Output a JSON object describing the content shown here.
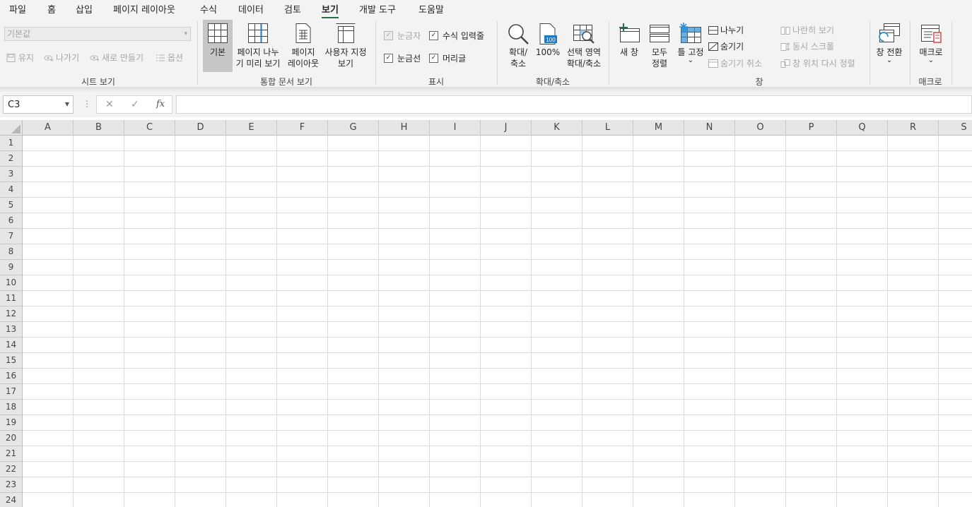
{
  "menu_tabs": [
    "파일",
    "홈",
    "삽입",
    "페이지 레이아웃",
    "수식",
    "데이터",
    "검토",
    "보기",
    "개발 도구",
    "도움말"
  ],
  "active_tab": "보기",
  "ribbon": {
    "sheet_view": {
      "select_value": "기본값",
      "keep": "유지",
      "exit": "나가기",
      "new": "새로 만들기",
      "options": "옵션",
      "group_label": "시트 보기"
    },
    "workbook_views": {
      "normal": "기본",
      "page_break": "페이지 나누\n기 미리 보기",
      "page_layout": "페이지\n레이아웃",
      "custom": "사용자 지정\n보기",
      "group_label": "통합 문서 보기"
    },
    "show": {
      "ruler": "눈금자",
      "formula_bar": "수식 입력줄",
      "gridlines": "눈금선",
      "headings": "머리글",
      "group_label": "표시"
    },
    "zoom": {
      "zoom": "확대/\n축소",
      "hundred": "100%",
      "to_selection": "선택 영역\n확대/축소",
      "group_label": "확대/축소",
      "icon_text": "100"
    },
    "window": {
      "new_window": "새 창",
      "arrange_all": "모두\n정렬",
      "freeze": "틀 고정",
      "split": "나누기",
      "hide": "숨기기",
      "unhide": "숨기기 취소",
      "side_by_side": "나란히 보기",
      "sync_scroll": "동시 스크롤",
      "reset_position": "창 위치 다시 정렬",
      "switch": "창 전환",
      "group_label": "창"
    },
    "macros": {
      "macros": "매크로",
      "group_label": "매크로"
    }
  },
  "formula_bar": {
    "name_box": "C3",
    "formula": "",
    "fx_label": "fx"
  },
  "grid": {
    "columns": [
      "A",
      "B",
      "C",
      "D",
      "E",
      "F",
      "G",
      "H",
      "I",
      "J",
      "K",
      "L",
      "M",
      "N",
      "O",
      "P",
      "Q",
      "R",
      "S"
    ],
    "rows": [
      "1",
      "2",
      "3",
      "4",
      "5",
      "6",
      "7",
      "8",
      "9",
      "10",
      "11",
      "12",
      "13",
      "14",
      "15",
      "16",
      "17",
      "18",
      "19",
      "20",
      "21",
      "22",
      "23",
      "24"
    ]
  },
  "colors": {
    "accent": "#217346",
    "ribbon_bg": "#f3f3f3",
    "gridline": "#dcdcdc",
    "header_bg": "#e6e6e6",
    "pressed_button": "#c6c6c6",
    "zoom_badge": "#1e7ac4",
    "freeze_icon": "#2e8fd4",
    "macro_icon": "#d83b3b"
  },
  "icons": {
    "select_arrow": "▾",
    "namebox_arrow": "▼",
    "fbar_dots": "⋮",
    "cancel": "✕",
    "confirm": "✓",
    "check": "✓",
    "dropdown": "⌄"
  }
}
